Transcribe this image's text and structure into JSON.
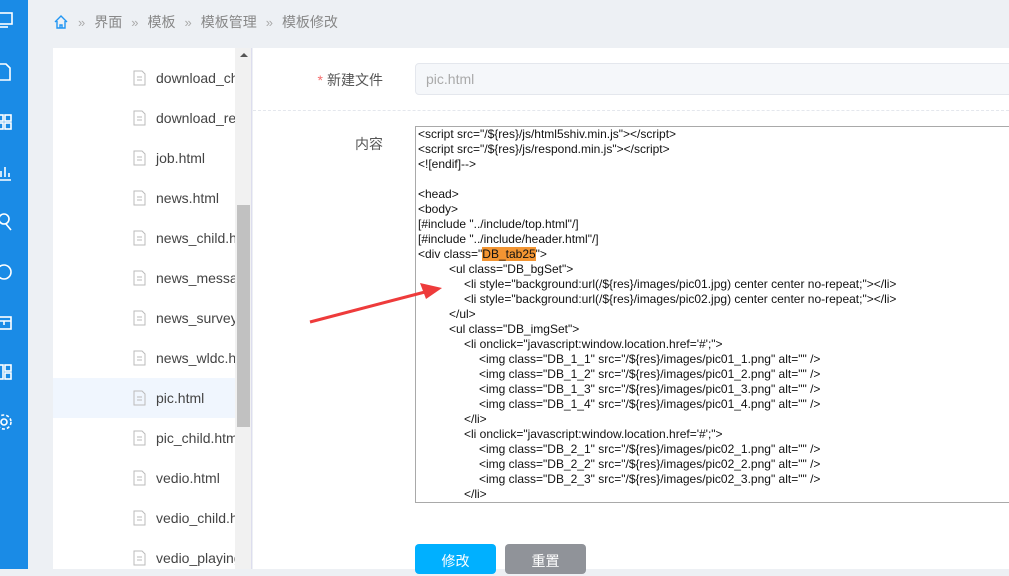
{
  "breadcrumb": [
    "界面",
    "模板",
    "模板管理",
    "模板修改"
  ],
  "files": [
    "download_child.html",
    "download_re",
    "job.html",
    "news.html",
    "news_child.html",
    "news_message",
    "news_survey",
    "news_wldc.html",
    "pic.html",
    "pic_child.html",
    "vedio.html",
    "vedio_child.html",
    "vedio_playing"
  ],
  "selected_file": "pic.html",
  "form": {
    "filename_label": "新建文件",
    "filename_value": "pic.html",
    "content_label": "内容",
    "submit": "修改",
    "reset": "重置"
  },
  "code_lines": [
    {
      "i": 0,
      "t": "<script src=\"/${res}/js/html5shiv.min.js\"></script>"
    },
    {
      "i": 0,
      "t": "<script src=\"/${res}/js/respond.min.js\"></script>"
    },
    {
      "i": 0,
      "t": "<![endif]-->"
    },
    {
      "i": 0,
      "t": ""
    },
    {
      "i": 0,
      "t": "<head>"
    },
    {
      "i": 0,
      "t": "<body>"
    },
    {
      "i": 0,
      "t": "[#include \"../include/top.html\"/]"
    },
    {
      "i": 0,
      "t": "[#include \"../include/header.html\"/]"
    },
    {
      "i": 0,
      "t": "<div class=\"",
      "hl": "DB_tab25",
      "post": "\">"
    },
    {
      "i": 1,
      "t": "<ul class=\"DB_bgSet\">"
    },
    {
      "i": 2,
      "t": "<li style=\"background:url(/${res}/images/pic01.jpg) center center no-repeat;\"></li>"
    },
    {
      "i": 2,
      "t": "<li style=\"background:url(/${res}/images/pic02.jpg) center center no-repeat;\"></li>"
    },
    {
      "i": 1,
      "t": "</ul>"
    },
    {
      "i": 1,
      "t": "<ul class=\"DB_imgSet\">"
    },
    {
      "i": 2,
      "t": "<li onclick=\"javascript:window.location.href='#';\">"
    },
    {
      "i": 3,
      "t": "<img class=\"DB_1_1\" src=\"/${res}/images/pic01_1.png\" alt=\"\" />"
    },
    {
      "i": 3,
      "t": "<img class=\"DB_1_2\" src=\"/${res}/images/pic01_2.png\" alt=\"\" />"
    },
    {
      "i": 3,
      "t": "<img class=\"DB_1_3\" src=\"/${res}/images/pic01_3.png\" alt=\"\" />"
    },
    {
      "i": 3,
      "t": "<img class=\"DB_1_4\" src=\"/${res}/images/pic01_4.png\" alt=\"\" />"
    },
    {
      "i": 2,
      "t": "</li>"
    },
    {
      "i": 2,
      "t": "<li onclick=\"javascript:window.location.href='#';\">"
    },
    {
      "i": 3,
      "t": "<img class=\"DB_2_1\" src=\"/${res}/images/pic02_1.png\" alt=\"\" />"
    },
    {
      "i": 3,
      "t": "<img class=\"DB_2_2\" src=\"/${res}/images/pic02_2.png\" alt=\"\" />"
    },
    {
      "i": 3,
      "t": "<img class=\"DB_2_3\" src=\"/${res}/images/pic02_3.png\" alt=\"\" />"
    },
    {
      "i": 2,
      "t": "</li>"
    }
  ],
  "colors": {
    "sidebar": "#1a8be6",
    "primary_button": "#00b0ff",
    "reset_button": "#909399",
    "highlight": "#f39532",
    "arrow": "#ee3b3b"
  }
}
